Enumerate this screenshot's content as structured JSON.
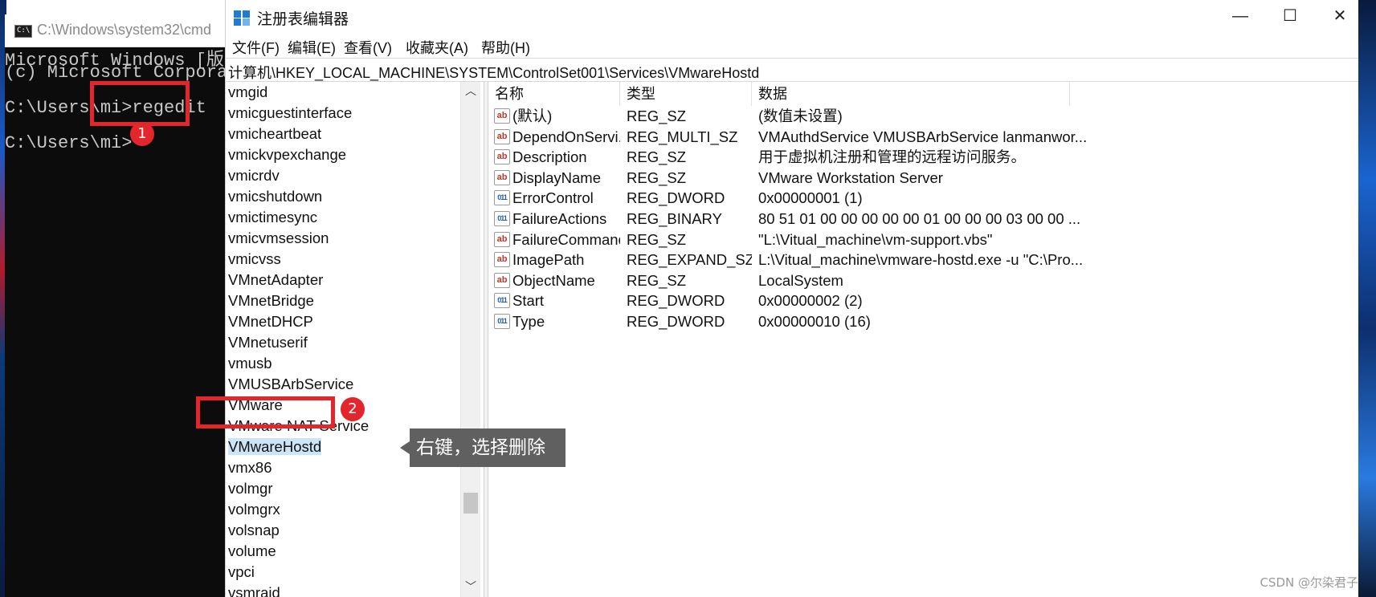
{
  "cmd": {
    "title": "C:\\Windows\\system32\\cmd",
    "icon": "cmd-icon",
    "lines": [
      "Microsoft Windows [版本",
      "(c) Microsoft Corporati",
      "C:\\Users\\mi>regedit",
      "C:\\Users\\mi>"
    ]
  },
  "regedit": {
    "title": "注册表编辑器",
    "window_buttons": {
      "minimize": "—",
      "maximize": "☐",
      "close": "✕"
    },
    "menu": [
      "文件(F)",
      "编辑(E)",
      "查看(V)",
      "收藏夹(A)",
      "帮助(H)"
    ],
    "address": "计算机\\HKEY_LOCAL_MACHINE\\SYSTEM\\ControlSet001\\Services\\VMwareHostd",
    "tree": {
      "items": [
        "vmgid",
        "vmicguestinterface",
        "vmicheartbeat",
        "vmickvpexchange",
        "vmicrdv",
        "vmicshutdown",
        "vmictimesync",
        "vmicvmsession",
        "vmicvss",
        "VMnetAdapter",
        "VMnetBridge",
        "VMnetDHCP",
        "VMnetuserif",
        "vmusb",
        "VMUSBArbService",
        "VMware",
        "VMware NAT Service",
        "VMwareHostd",
        "vmx86",
        "volmgr",
        "volmgrx",
        "volsnap",
        "volume",
        "vpci",
        "vsmraid"
      ],
      "selected": "VMwareHostd",
      "scroll_up": "︿",
      "scroll_down": "﹀"
    },
    "columns": {
      "name": "名称",
      "type": "类型",
      "data": "数据"
    },
    "values": [
      {
        "icon": "ab",
        "name": "(默认)",
        "type": "REG_SZ",
        "data": "(数值未设置)"
      },
      {
        "icon": "ab",
        "name": "DependOnServi...",
        "type": "REG_MULTI_SZ",
        "data": "VMAuthdService VMUSBArbService lanmanwor..."
      },
      {
        "icon": "ab",
        "name": "Description",
        "type": "REG_SZ",
        "data": "用于虚拟机注册和管理的远程访问服务。"
      },
      {
        "icon": "ab",
        "name": "DisplayName",
        "type": "REG_SZ",
        "data": "VMware Workstation Server"
      },
      {
        "icon": "bin",
        "name": "ErrorControl",
        "type": "REG_DWORD",
        "data": "0x00000001 (1)"
      },
      {
        "icon": "bin",
        "name": "FailureActions",
        "type": "REG_BINARY",
        "data": "80 51 01 00 00 00 00 00 01 00 00 00 03 00 00 ..."
      },
      {
        "icon": "ab",
        "name": "FailureCommand",
        "type": "REG_SZ",
        "data": "\"L:\\Vitual_machine\\vm-support.vbs\""
      },
      {
        "icon": "ab",
        "name": "ImagePath",
        "type": "REG_EXPAND_SZ",
        "data": "L:\\Vitual_machine\\vmware-hostd.exe -u \"C:\\Pro..."
      },
      {
        "icon": "ab",
        "name": "ObjectName",
        "type": "REG_SZ",
        "data": "LocalSystem"
      },
      {
        "icon": "bin",
        "name": "Start",
        "type": "REG_DWORD",
        "data": "0x00000002 (2)"
      },
      {
        "icon": "bin",
        "name": "Type",
        "type": "REG_DWORD",
        "data": "0x00000010 (16)"
      }
    ]
  },
  "annotations": {
    "step1": "1",
    "step2": "2",
    "tooltip": "右键，选择删除",
    "accent": "#e3262b"
  },
  "watermark": "CSDN @尔染君子"
}
